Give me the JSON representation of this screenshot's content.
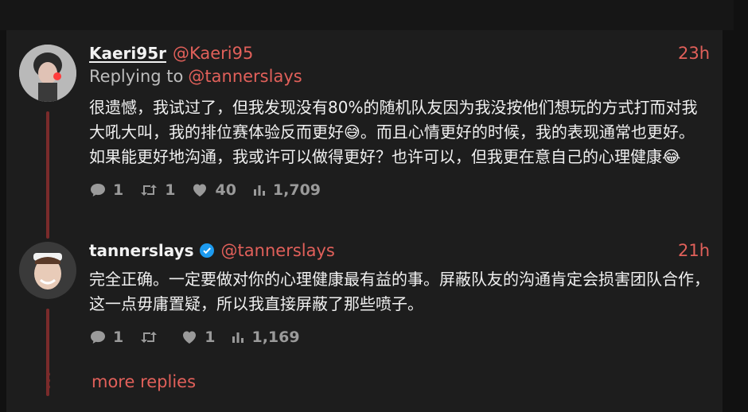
{
  "tweets": [
    {
      "display_name": "Kaeri95r",
      "handle": "@Kaeri95",
      "time": "23h",
      "replying_label": "Replying to",
      "replying_handle": "@tannerslays",
      "text": "很遗憾，我试过了，但我发现没有80%的随机队友因为我没按他们想玩的方式打而对我大吼大叫，我的排位赛体验反而更好😅。而且心情更好的时候，我的表现通常也更好。如果能更好地沟通，我或许可以做得更好？也许可以，但我更在意自己的心理健康😂",
      "stats": {
        "replies": "1",
        "retweets": "1",
        "likes": "40",
        "views": "1,709"
      }
    },
    {
      "display_name": "tannerslays",
      "handle": "@tannerslays",
      "time": "21h",
      "text": "完全正确。一定要做对你的心理健康最有益的事。屏蔽队友的沟通肯定会损害团队合作，这一点毋庸置疑，所以我直接屏蔽了那些喷子。",
      "stats": {
        "replies": "1",
        "retweets": "",
        "likes": "1",
        "views": "1,169"
      }
    }
  ],
  "more_replies": "more replies",
  "colors": {
    "accent": "#e1605a",
    "thread": "#7a2b2b",
    "verified": "#1d9bf0"
  }
}
